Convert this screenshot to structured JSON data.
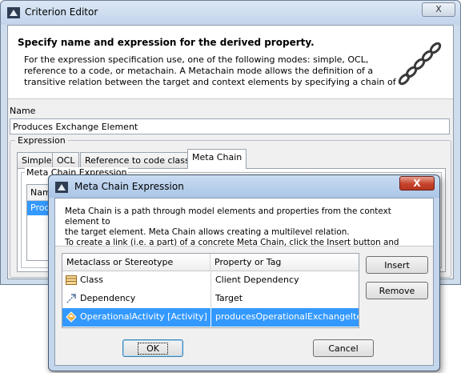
{
  "criterion_editor": {
    "title": "Criterion Editor",
    "close_label": "X",
    "header_title": "Specify name and expression for the derived property.",
    "header_description": "For the expression specification use, one of the following modes: simple, OCL, reference to a code, or metachain. A Metachain mode allows the definition of a transitive relation between the target and context elements by specifying a chain of interconnections between",
    "name_label": "Name",
    "name_value": "Produces Exchange Element",
    "expression_label": "Expression",
    "tabs": [
      {
        "label": "Simple"
      },
      {
        "label": "OCL"
      },
      {
        "label": "Reference to code class"
      },
      {
        "label": "Meta Chain"
      }
    ],
    "active_tab": "Meta Chain",
    "meta_chain_expression_label": "Meta Chain Expression",
    "table_header_partial": "Nam",
    "table_row_partial": "Produ"
  },
  "meta_chain_dialog": {
    "title": "Meta Chain Expression",
    "close_label": "X",
    "description_lines": [
      "Meta Chain is a path through model elements and properties from the context element to",
      "the target element. Meta Chain allows creating a multilevel relation.",
      "To create a link (i.e. a part) of a concrete Meta Chain, click the Insert button and select a"
    ],
    "columns": [
      "Metaclass or Stereotype",
      "Property or Tag"
    ],
    "rows": [
      {
        "metaclass": "Class",
        "property": "Client Dependency",
        "icon": "class-icon",
        "selected": false
      },
      {
        "metaclass": "Dependency",
        "property": "Target",
        "icon": "dependency-arrow-icon",
        "selected": false
      },
      {
        "metaclass": "OperationalActivity [Activity]",
        "property": "producesOperationalExchangeItems",
        "icon": "operational-activity-icon",
        "selected": true
      }
    ],
    "insert_label": "Insert",
    "remove_label": "Remove",
    "ok_label": "OK",
    "cancel_label": "Cancel"
  },
  "colors": {
    "selection": "#3399ff",
    "dialog_frame": "#c4d6ec",
    "close_button": "#c5422c"
  }
}
